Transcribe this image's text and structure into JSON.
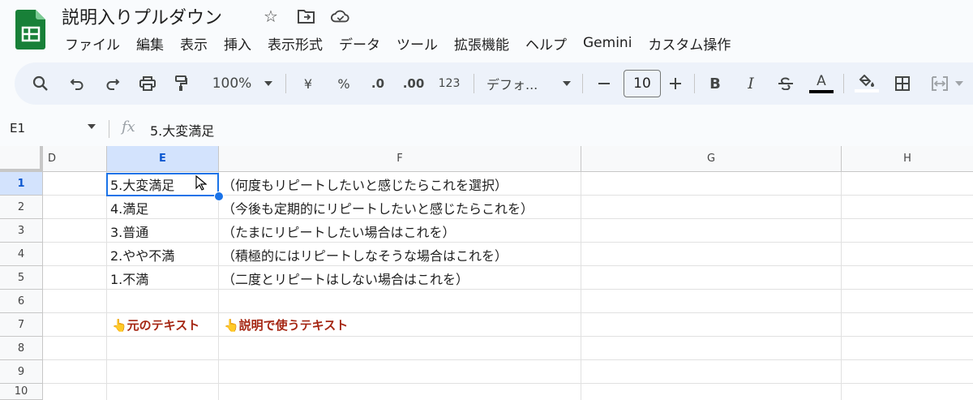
{
  "app": {
    "title": "説明入りプルダウン",
    "menu": [
      "ファイル",
      "編集",
      "表示",
      "挿入",
      "表示形式",
      "データ",
      "ツール",
      "拡張機能",
      "ヘルプ",
      "Gemini",
      "カスタム操作"
    ],
    "brand_color": "#188038"
  },
  "toolbar": {
    "zoom": "100%",
    "currency": "¥",
    "percent": "%",
    "decimal_decrease": ".0",
    "decimal_increase": ".00",
    "number_format": "123",
    "font": "デフォ...",
    "font_size": "10",
    "bold": "B",
    "italic": "I",
    "text_color_label": "A",
    "icons": [
      "search-icon",
      "undo-icon",
      "redo-icon",
      "print-icon",
      "paint-format-icon",
      "zoom-dropdown-icon",
      "font-dropdown-icon",
      "minus-icon",
      "plus-icon",
      "strikethrough-icon",
      "text-color-icon",
      "fill-color-icon",
      "borders-icon",
      "merge-cells-icon"
    ]
  },
  "formula_bar": {
    "name_box": "E1",
    "fx": "fx",
    "content": "5.大変満足"
  },
  "grid": {
    "columns": [
      "D",
      "E",
      "F",
      "G",
      "H"
    ],
    "selected_column": "E",
    "rows": [
      "1",
      "2",
      "3",
      "4",
      "5",
      "6",
      "7",
      "8",
      "9",
      "10"
    ],
    "selected_row": "1",
    "col_e": [
      "5.大変満足",
      "4.満足",
      "3.普通",
      "2.やや不満",
      "1.不満"
    ],
    "col_f": [
      "（何度もリピートしたいと感じたらこれを選択）",
      "（今後も定期的にリピートしたいと感じたらこれを）",
      "（たまにリピートしたい場合はこれを）",
      "（積極的にはリピートしなそうな場合はこれを）",
      "（二度とリピートはしない場合はこれを）"
    ],
    "note_e7": "👆元のテキスト",
    "note_f7": "👆説明で使うテキスト",
    "selection_color": "#1a73e8",
    "note_color": "#a52714"
  }
}
